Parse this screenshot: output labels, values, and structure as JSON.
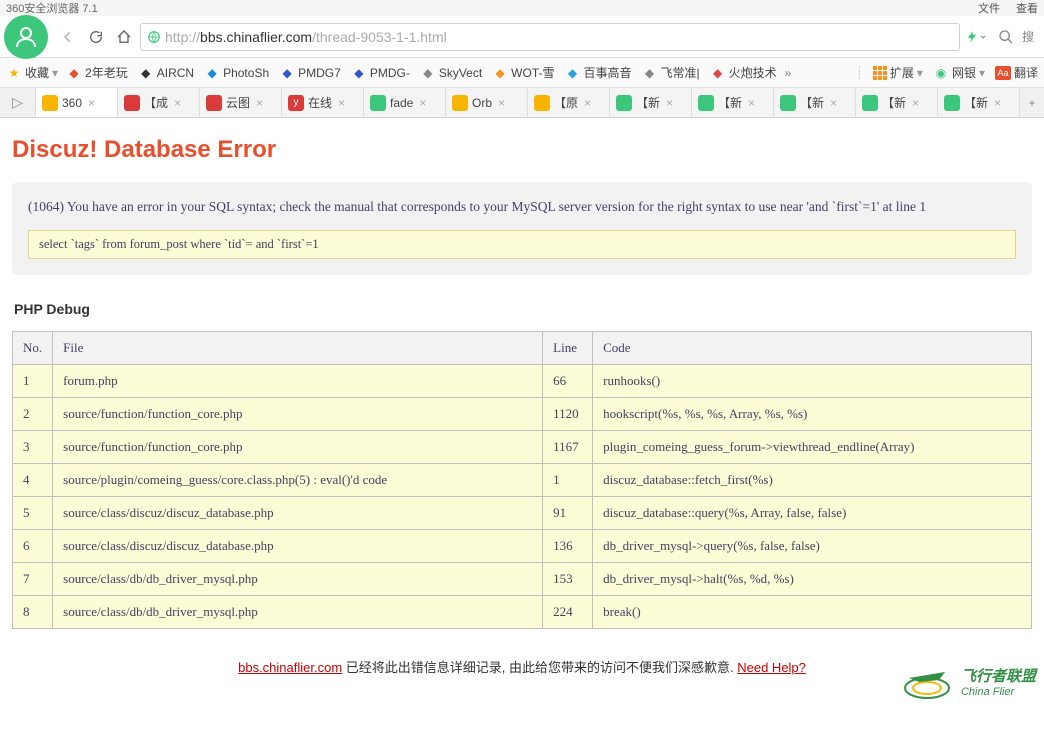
{
  "titlebar": {
    "left": "360安全浏览器 7.1",
    "menu_file": "文件",
    "menu_view": "查看"
  },
  "url": {
    "grey_prefix": "http://",
    "host": "bbs.chinaflier.com",
    "path": "/thread-9053-1-1.html"
  },
  "chrome_right": {
    "search_placeholder": "搜"
  },
  "bookmarks": {
    "favorites_label": "收藏",
    "items": [
      {
        "label": "2年老玩",
        "color": "#e94f2d"
      },
      {
        "label": "AIRCN",
        "color": "#333"
      },
      {
        "label": "PhotoSh",
        "color": "#1c8adb"
      },
      {
        "label": "PMDG7",
        "color": "#3355cc"
      },
      {
        "label": "PMDG-",
        "color": "#3355cc"
      },
      {
        "label": "SkyVect",
        "color": "#888"
      },
      {
        "label": "WOT-雪",
        "color": "#f7931e"
      },
      {
        "label": "百事高音",
        "color": "#2aa1d6"
      },
      {
        "label": "飞常准|",
        "color": "#888"
      },
      {
        "label": "火炮技术",
        "color": "#d44"
      }
    ],
    "more": "»",
    "ext_label": "扩展",
    "netbank_label": "网银",
    "translate_label": "翻译"
  },
  "tabs": [
    {
      "label": "360",
      "ico_bg": "#f7b500",
      "close": true,
      "active": true
    },
    {
      "label": "【成",
      "ico_bg": "#d93a3a",
      "close": true
    },
    {
      "label": "云图",
      "ico_bg": "#d93a3a",
      "close": true
    },
    {
      "label": "在线",
      "ico_bg": "#d93a3a",
      "close": true,
      "ico_text": "y"
    },
    {
      "label": "fade",
      "ico_bg": "#3cc77c",
      "close": true
    },
    {
      "label": "Orb",
      "ico_bg": "#f7b500",
      "close": true
    },
    {
      "label": "【原",
      "ico_bg": "#f7b500",
      "close": true
    },
    {
      "label": "【新",
      "ico_bg": "#3cc77c",
      "close": true
    },
    {
      "label": "【新",
      "ico_bg": "#3cc77c",
      "close": true
    },
    {
      "label": "【新",
      "ico_bg": "#3cc77c",
      "close": true
    },
    {
      "label": "【新",
      "ico_bg": "#3cc77c",
      "close": true
    },
    {
      "label": "【新",
      "ico_bg": "#3cc77c",
      "close": true
    }
  ],
  "error": {
    "title": "Discuz! Database Error",
    "message": "(1064) You have an error in your SQL syntax; check the manual that corresponds to your MySQL server version for the right syntax to use near 'and `first`=1' at line 1",
    "sql": "select `tags` from forum_post where `tid`= and `first`=1"
  },
  "debug": {
    "heading": "PHP Debug",
    "cols": {
      "no": "No.",
      "file": "File",
      "line": "Line",
      "code": "Code"
    },
    "rows": [
      {
        "no": "1",
        "file": "forum.php",
        "line": "66",
        "code": "runhooks()"
      },
      {
        "no": "2",
        "file": "source/function/function_core.php",
        "line": "1120",
        "code": "hookscript(%s, %s, %s, Array, %s, %s)"
      },
      {
        "no": "3",
        "file": "source/function/function_core.php",
        "line": "1167",
        "code": "plugin_comeing_guess_forum->viewthread_endline(Array)"
      },
      {
        "no": "4",
        "file": "source/plugin/comeing_guess/core.class.php(5) : eval()'d code",
        "line": "1",
        "code": "discuz_database::fetch_first(%s)"
      },
      {
        "no": "5",
        "file": "source/class/discuz/discuz_database.php",
        "line": "91",
        "code": "discuz_database::query(%s, Array, false, false)"
      },
      {
        "no": "6",
        "file": "source/class/discuz/discuz_database.php",
        "line": "136",
        "code": "db_driver_mysql->query(%s, false, false)"
      },
      {
        "no": "7",
        "file": "source/class/db/db_driver_mysql.php",
        "line": "153",
        "code": "db_driver_mysql->halt(%s, %d, %s)"
      },
      {
        "no": "8",
        "file": "source/class/db/db_driver_mysql.php",
        "line": "224",
        "code": "break()"
      }
    ]
  },
  "footer": {
    "domain": "bbs.chinaflier.com",
    "text": " 已经将此出错信息详细记录, 由此给您带来的访问不便我们深感歉意. ",
    "help": "Need Help?"
  },
  "watermark": {
    "cn": "飞行者联盟",
    "en": "China Flier"
  }
}
